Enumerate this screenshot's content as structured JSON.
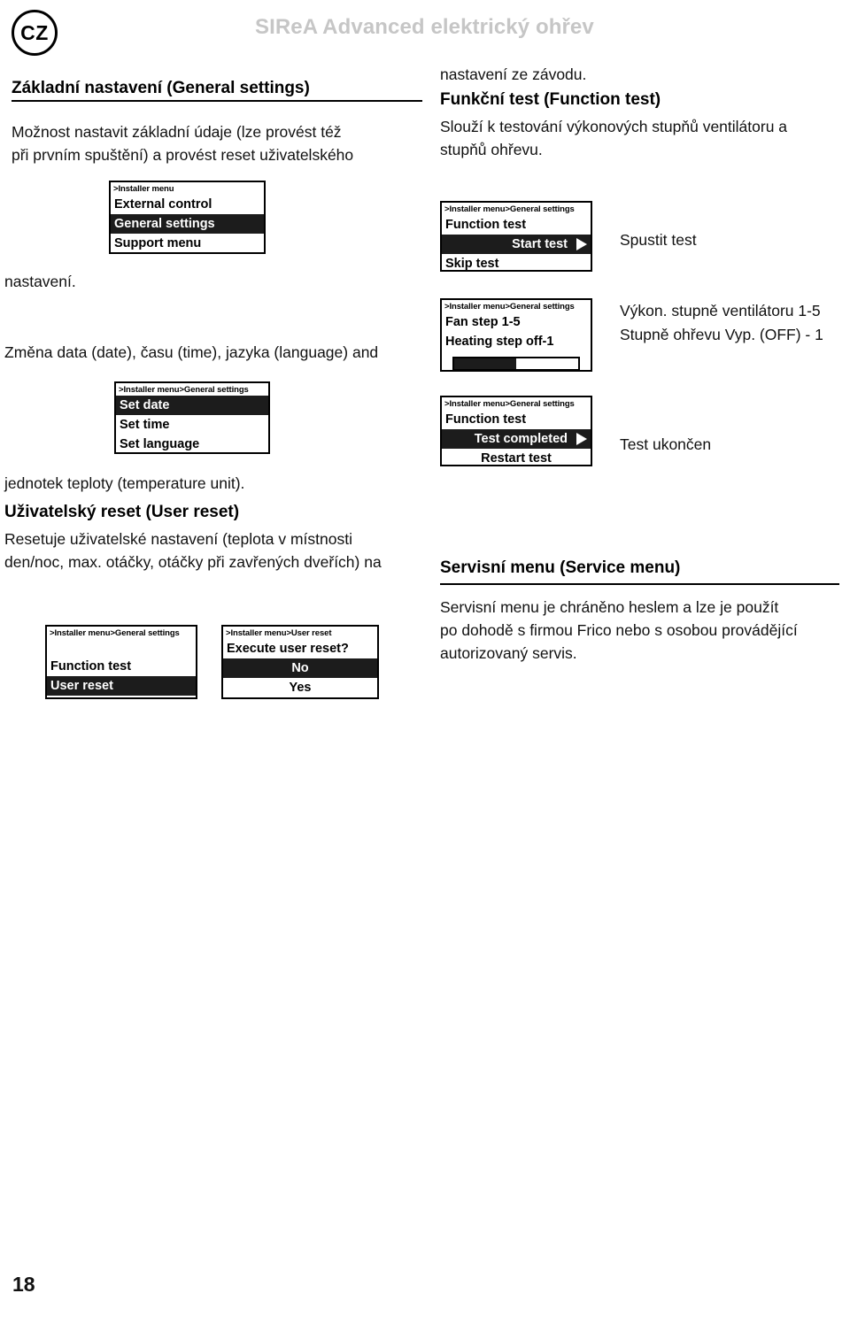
{
  "header": {
    "country_badge": "CZ",
    "title": "SIReA Advanced elektrický ohřev"
  },
  "left_column": {
    "section1_heading": "Základní nastavení (General settings)",
    "section1_body_line1": "Možnost nastavit základní údaje (lze provést též",
    "section1_body_line2": "při prvním spuštění) a provést reset uživatelského",
    "section1_body_line3": "nastavení.",
    "para2_line1": "Změna data (date), času (time), jazyka (language) and",
    "para2_line2": "jednotek teploty (temperature unit).",
    "section2_heading": "Uživatelský reset (User reset)",
    "section2_body_line1": "Resetuje uživatelské nastavení (teplota v místnosti",
    "section2_body_line2": "den/noc, max. otáčky, otáčky při zavřených dveřích) na"
  },
  "right_column": {
    "intro_line": "nastavení ze závodu.",
    "section3_heading": "Funkční test (Function test)",
    "section3_body_line1": "Slouží k testování výkonových stupňů ventilátoru a",
    "section3_body_line2": "stupňů ohřevu.",
    "section4_heading": "Servisní menu (Service menu)",
    "section4_body_line1": "Servisní menu je chráněno heslem a lze je použít",
    "section4_body_line2": "po dohodě s firmou Frico nebo s osobou provádějící",
    "section4_body_line3": "autorizovaný servis."
  },
  "annotations": {
    "start_test": "Spustit test",
    "fan_steps": "Výkon. stupně ventilátoru 1-5",
    "heat_steps": "Stupně ohřevu Vyp. (OFF) - 1",
    "test_done": "Test ukončen"
  },
  "screens": {
    "installer_menu": {
      "breadcrumb": ">Installer menu",
      "rows": [
        {
          "label": "External control",
          "selected": false
        },
        {
          "label": "General settings",
          "selected": true
        },
        {
          "label": "Support menu",
          "selected": false
        }
      ]
    },
    "general_settings": {
      "breadcrumb": ">Installer menu>General settings",
      "rows": [
        {
          "label": "Set date",
          "selected": true
        },
        {
          "label": "Set time",
          "selected": false
        },
        {
          "label": "Set language",
          "selected": false
        }
      ]
    },
    "general_settings_list": {
      "breadcrumb": ">Installer menu>General settings",
      "rows": [
        {
          "label": "Function test",
          "selected": false
        },
        {
          "label": "User reset",
          "selected": true
        }
      ]
    },
    "user_reset_confirm": {
      "breadcrumb": ">Installer menu>User reset",
      "question": "Execute user reset?",
      "rows": [
        {
          "label": "No",
          "selected": true
        },
        {
          "label": "Yes",
          "selected": false
        }
      ]
    },
    "function_test_start": {
      "breadcrumb": ">Installer menu>General settings",
      "title": "Function test",
      "rows": [
        {
          "label": "Start test",
          "selected": true,
          "arrow": true
        },
        {
          "label": "Skip test",
          "selected": false,
          "arrow": false
        }
      ]
    },
    "function_test_running": {
      "breadcrumb": ">Installer menu>General settings",
      "line1": "Fan step 1-5",
      "line2": "Heating step off-1",
      "progress_percent": 50
    },
    "function_test_done": {
      "breadcrumb": ">Installer menu>General settings",
      "title": "Function test",
      "rows": [
        {
          "label": "Test completed",
          "selected": true,
          "arrow": true
        },
        {
          "label": "Restart test",
          "selected": false,
          "arrow": false
        }
      ]
    }
  },
  "footer": {
    "page_number": "18"
  },
  "colors": {
    "lcd_selected_bg": "#1c1c1c",
    "title_gray": "#c6c6c6",
    "ink": "#111111"
  }
}
